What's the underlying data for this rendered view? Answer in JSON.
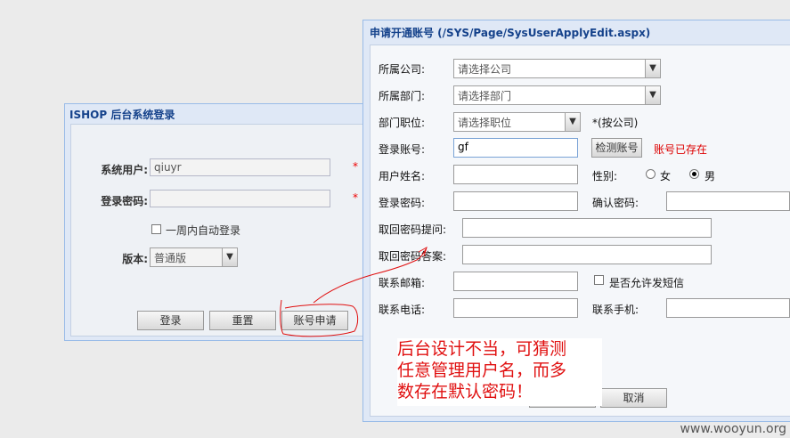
{
  "login": {
    "title": "ISHOP 后台系统登录",
    "user_label": "系统用户:",
    "user_value": "qiuyr",
    "password_label": "登录密码:",
    "required_mark": "*",
    "remember_label": "一周内自动登录",
    "version_label": "版本:",
    "version_value": "普通版",
    "buttons": {
      "login": "登录",
      "reset": "重置",
      "apply": "账号申请"
    }
  },
  "apply": {
    "title": "申请开通账号 (/SYS/Page/SysUserApplyEdit.aspx)",
    "company_label": "所属公司:",
    "company_value": "请选择公司",
    "dept_label": "所属部门:",
    "dept_value": "请选择部门",
    "position_label": "部门职位:",
    "position_value": "请选择职位",
    "position_hint": "*(按公司)",
    "account_label": "登录账号:",
    "account_value": "gf",
    "check_button": "检测账号",
    "account_status": "账号已存在",
    "name_label": "用户姓名:",
    "gender_label": "性别:",
    "gender_female": "女",
    "gender_male": "男",
    "password_label": "登录密码:",
    "confirm_label": "确认密码:",
    "question_label": "取回密码提问:",
    "answer_label": "取回密码答案:",
    "email_label": "联系邮箱:",
    "sms_label": "是否允许发短信",
    "phone_label": "联系电话:",
    "mobile_label": "联系手机:",
    "cancel_button": "取消"
  },
  "annotation": {
    "line1": "后台设计不当，可猜测",
    "line2": "任意管理用户名，而多",
    "line3": "数存在默认密码！"
  },
  "watermark": "www.wooyun.org",
  "colors": {
    "title": "#15428b",
    "annotation": "#e01010",
    "required": "#e00000"
  }
}
